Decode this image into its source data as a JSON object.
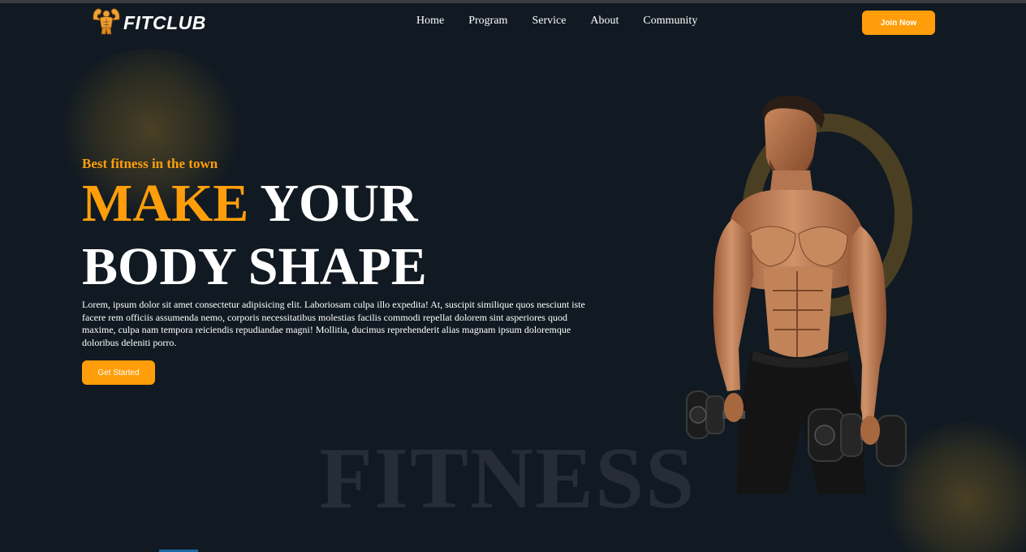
{
  "brand": {
    "logo_icon": "flexing-muscle-man-icon",
    "name": "FITCLUB"
  },
  "nav": {
    "items": [
      "Home",
      "Program",
      "Service",
      "About",
      "Community"
    ]
  },
  "header": {
    "join_label": "Join Now"
  },
  "hero": {
    "tagline": "Best fitness in the town",
    "headline_accent": "MAKE",
    "headline_rest_1": " YOUR",
    "headline_line_2": "BODY SHAPE",
    "description": "Lorem, ipsum dolor sit amet consectetur adipisicing elit. Laboriosam culpa illo expedita! At, suscipit similique quos nesciunt iste facere rem officiis assumenda nemo, corporis necessitatibus molestias facilis commodi repellat dolorem sint asperiores quod maxime, culpa nam tempora reiciendis repudiandae magni! Mollitia, ducimus reprehenderit alias magnam ipsum doloremque doloribus deleniti porro.",
    "cta_label": "Get Started",
    "watermark": "FITNESS",
    "image": "muscular-man-holding-dumbbells"
  },
  "colors": {
    "background": "#111a22",
    "accent": "#ff9e0a",
    "watermark": "#262d37",
    "ring": "#4a3f23"
  }
}
